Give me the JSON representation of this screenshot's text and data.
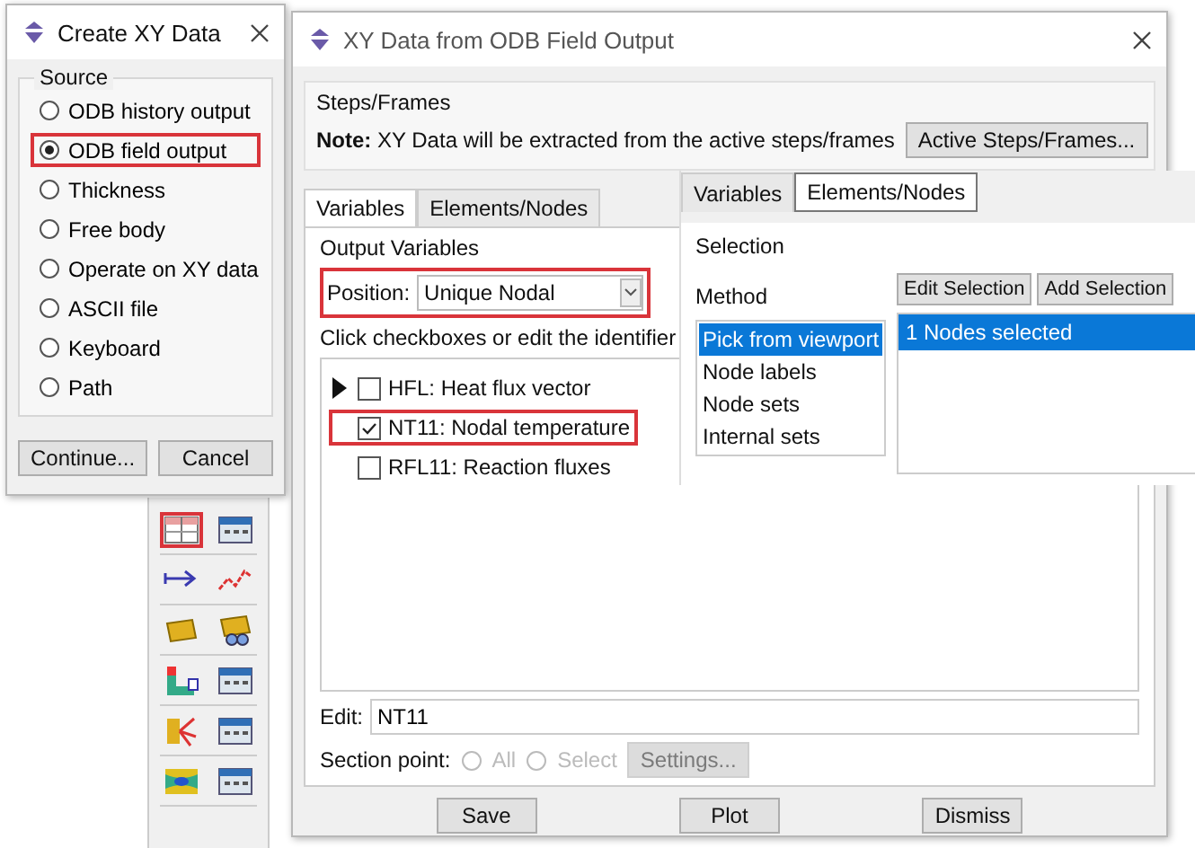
{
  "create_dialog": {
    "title": "Create XY Data",
    "group_title": "Source",
    "options": [
      {
        "label": "ODB history output",
        "selected": false,
        "highlighted": false
      },
      {
        "label": "ODB field output",
        "selected": true,
        "highlighted": true
      },
      {
        "label": "Thickness",
        "selected": false,
        "highlighted": false
      },
      {
        "label": "Free body",
        "selected": false,
        "highlighted": false
      },
      {
        "label": "Operate on XY data",
        "selected": false,
        "highlighted": false
      },
      {
        "label": "ASCII file",
        "selected": false,
        "highlighted": false
      },
      {
        "label": "Keyboard",
        "selected": false,
        "highlighted": false
      },
      {
        "label": "Path",
        "selected": false,
        "highlighted": false
      }
    ],
    "buttons": [
      "Continue...",
      "Cancel"
    ]
  },
  "toolbar": {
    "tools": [
      {
        "kind": "xy-table",
        "highlighted": true
      },
      {
        "kind": "table",
        "highlighted": false
      },
      {
        "kind": "arrow",
        "highlighted": false
      },
      {
        "kind": "line-plot",
        "highlighted": false
      },
      {
        "kind": "shape",
        "highlighted": false
      },
      {
        "kind": "shape-group",
        "highlighted": false
      },
      {
        "kind": "contour",
        "highlighted": false
      },
      {
        "kind": "table",
        "highlighted": false
      },
      {
        "kind": "fan",
        "highlighted": false
      },
      {
        "kind": "table",
        "highlighted": false
      },
      {
        "kind": "flow",
        "highlighted": false
      },
      {
        "kind": "table",
        "highlighted": false
      }
    ]
  },
  "field_dialog": {
    "title": "XY Data from ODB Field Output",
    "steps": {
      "group_title": "Steps/Frames",
      "note_label": "Note:",
      "note": "XY Data will be extracted from the active steps/frames",
      "button": "Active Steps/Frames..."
    },
    "tabs": [
      {
        "label": "Variables",
        "selected": true
      },
      {
        "label": "Elements/Nodes",
        "selected": false
      }
    ],
    "output_variables": {
      "group_title": "Output Variables",
      "position_label": "Position:",
      "position_value": "Unique Nodal",
      "hint": "Click checkboxes or edit the identifier",
      "variables": [
        {
          "label": "HFL: Heat flux vector",
          "checked": false,
          "expandable": true,
          "highlighted": false
        },
        {
          "label": "NT11: Nodal temperature",
          "checked": true,
          "expandable": false,
          "highlighted": true
        },
        {
          "label": "RFL11: Reaction fluxes",
          "checked": false,
          "expandable": false,
          "highlighted": false
        }
      ]
    },
    "edit": {
      "label": "Edit:",
      "value": "NT11"
    },
    "section_point": {
      "label": "Section point:",
      "options": [
        {
          "label": "All",
          "selected": false
        },
        {
          "label": "Select",
          "selected": false
        }
      ],
      "button": "Settings...",
      "disabled": true
    },
    "buttons": [
      "Save",
      "Plot",
      "Dismiss"
    ]
  },
  "overlay_panel": {
    "tabs": [
      {
        "label": "Variables",
        "selected": false
      },
      {
        "label": "Elements/Nodes",
        "selected": true
      }
    ],
    "group_title": "Selection",
    "method_label": "Method",
    "methods": [
      {
        "label": "Pick from viewport",
        "selected": true
      },
      {
        "label": "Node labels",
        "selected": false
      },
      {
        "label": "Node sets",
        "selected": false
      },
      {
        "label": "Internal sets",
        "selected": false
      }
    ],
    "buttons": [
      "Edit Selection",
      "Add Selection"
    ],
    "selections": [
      {
        "label": "1 Nodes selected",
        "selected": true
      }
    ]
  }
}
